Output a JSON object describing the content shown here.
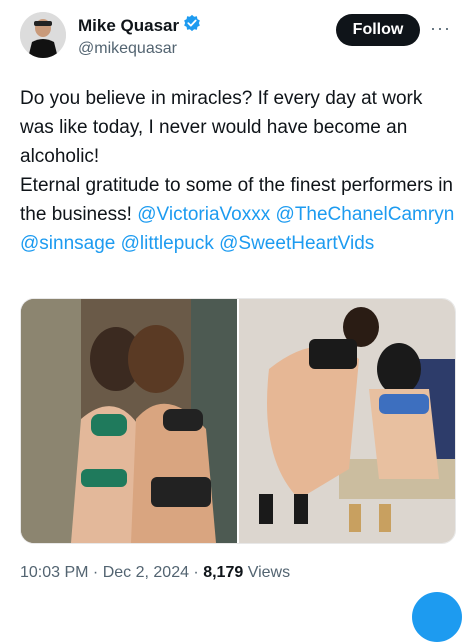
{
  "user": {
    "name": "Mike Quasar",
    "handle": "@mikequasar",
    "verified_color": "#1d9bf0"
  },
  "actions": {
    "follow_label": "Follow",
    "more_label": "···"
  },
  "tweet": {
    "line1": "Do you believe in miracles? If every day at work was like today, I never would have become an alcoholic!",
    "line2_text": "Eternal gratitude to some of the finest performers in the business! ",
    "mentions": [
      "@VictoriaVoxxx",
      "@TheChanelCamryn",
      "@sinnsage",
      "@littlepuck",
      "@SweetHeartVids"
    ]
  },
  "media": {
    "photos": [
      "photo-1",
      "photo-2"
    ]
  },
  "meta": {
    "time": "10:03 PM",
    "date": "Dec 2, 2024",
    "views_count": "8,179",
    "views_label": "Views"
  },
  "colors": {
    "accent": "#1d9bf0",
    "text": "#0f1419",
    "secondary": "#536471"
  }
}
